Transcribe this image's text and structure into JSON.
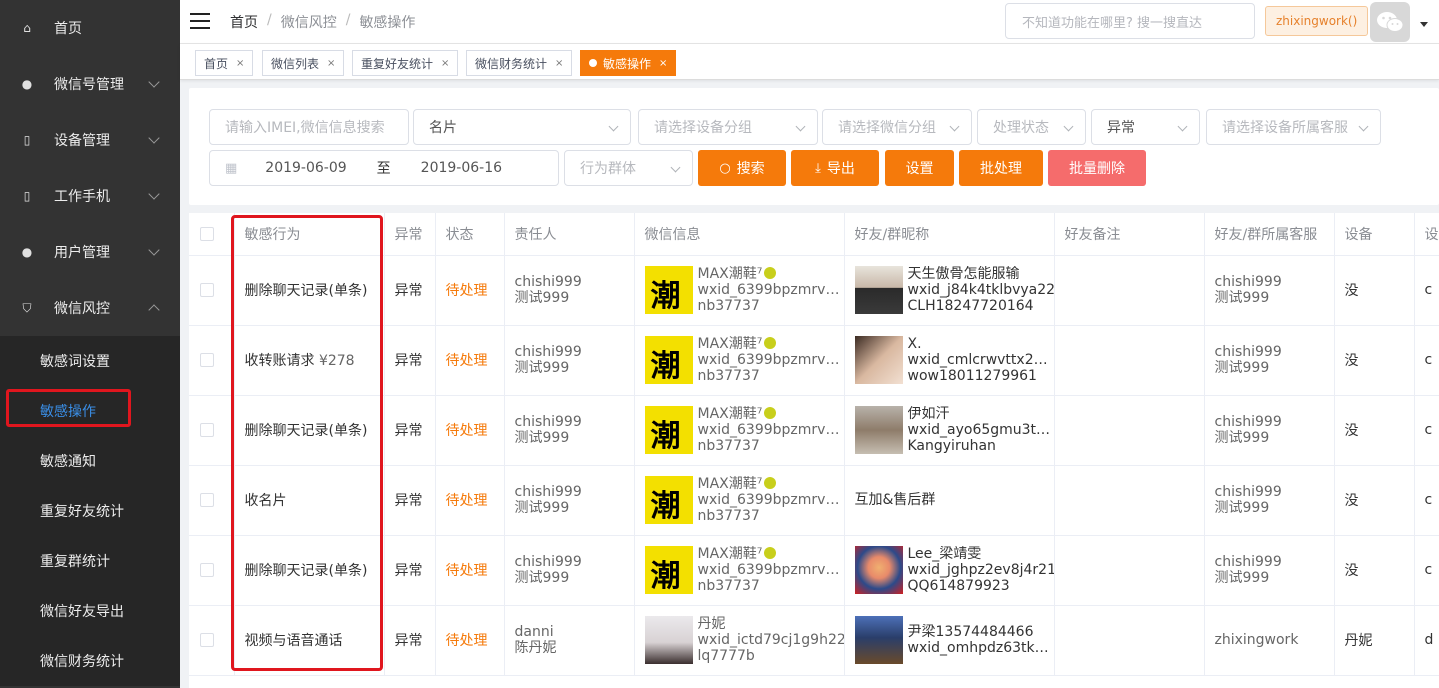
{
  "sidebar": {
    "items": [
      {
        "label": "首页",
        "icon": "home-icon"
      },
      {
        "label": "微信号管理",
        "icon": "wechat-icon"
      },
      {
        "label": "设备管理",
        "icon": "device-icon"
      },
      {
        "label": "工作手机",
        "icon": "phone-icon"
      },
      {
        "label": "用户管理",
        "icon": "user-icon"
      },
      {
        "label": "微信风控",
        "icon": "shield-icon"
      }
    ],
    "submenu": [
      "敏感词设置",
      "敏感操作",
      "敏感通知",
      "重复好友统计",
      "重复群统计",
      "微信好友导出",
      "微信财务统计"
    ]
  },
  "header": {
    "breadcrumb": [
      "首页",
      "微信风控",
      "敏感操作"
    ],
    "search_placeholder": "不知道功能在哪里? 搜一搜直达",
    "user_tag": "zhixingwork()"
  },
  "tags": [
    "首页",
    "微信列表",
    "重复好友统计",
    "微信财务统计",
    "敏感操作"
  ],
  "filters": {
    "imei_placeholder": "请输入IMEI,微信信息搜索",
    "type_value": "名片",
    "device_group": "请选择设备分组",
    "wechat_group": "请选择微信分组",
    "status": "处理状态",
    "abnormal": "异常",
    "service": "请选择设备所属客服",
    "date_from": "2019-06-09",
    "date_to_label": "至",
    "date_to": "2019-06-16",
    "behavior_group": "行为群体",
    "search_btn": "搜索",
    "export_btn": "导出",
    "settings_btn": "设置",
    "batch_btn": "批处理",
    "batch_delete_btn": "批量删除"
  },
  "table": {
    "columns": [
      "敏感行为",
      "异常",
      "状态",
      "责任人",
      "微信信息",
      "好友/群昵称",
      "好友备注",
      "好友/群所属客服",
      "设备",
      "设"
    ],
    "rows": [
      {
        "action": "删除聊天记录(单条)",
        "amount": "",
        "abnormal": "异常",
        "status": "待处理",
        "owner": [
          "chishi999",
          "测试999"
        ],
        "wx": [
          "MAX潮鞋⁷",
          "wxid_6399bpzmrv…",
          "nb37737"
        ],
        "wx_thumb": "yellow",
        "friend": [
          "天生傲骨怎能服输",
          "wxid_j84k4tklbvya22",
          "CLH18247720164"
        ],
        "friend_thumb": "p1",
        "remark": "",
        "service": [
          "chishi999",
          "测试999"
        ],
        "device": "没",
        "extra": "c"
      },
      {
        "action": "收转账请求",
        "amount": "¥278",
        "abnormal": "异常",
        "status": "待处理",
        "owner": [
          "chishi999",
          "测试999"
        ],
        "wx": [
          "MAX潮鞋⁷",
          "wxid_6399bpzmrv…",
          "nb37737"
        ],
        "wx_thumb": "yellow",
        "friend": [
          "X.",
          "wxid_cmlcrwvttx2…",
          "wow18011279961"
        ],
        "friend_thumb": "p2",
        "remark": "",
        "service": [
          "chishi999",
          "测试999"
        ],
        "device": "没",
        "extra": "c"
      },
      {
        "action": "删除聊天记录(单条)",
        "amount": "",
        "abnormal": "异常",
        "status": "待处理",
        "owner": [
          "chishi999",
          "测试999"
        ],
        "wx": [
          "MAX潮鞋⁷",
          "wxid_6399bpzmrv…",
          "nb37737"
        ],
        "wx_thumb": "yellow",
        "friend": [
          "伊如汗",
          "wxid_ayo65gmu3t…",
          "Kangyiruhan"
        ],
        "friend_thumb": "p3",
        "remark": "",
        "service": [
          "chishi999",
          "测试999"
        ],
        "device": "没",
        "extra": "c"
      },
      {
        "action": "收名片",
        "amount": "",
        "abnormal": "异常",
        "status": "待处理",
        "owner": [
          "chishi999",
          "测试999"
        ],
        "wx": [
          "MAX潮鞋⁷",
          "wxid_6399bpzmrv…",
          "nb37737"
        ],
        "wx_thumb": "yellow",
        "friend": [
          "互加&售后群",
          "",
          ""
        ],
        "friend_thumb": "",
        "remark": "",
        "service": [
          "chishi999",
          "测试999"
        ],
        "device": "没",
        "extra": "c"
      },
      {
        "action": "删除聊天记录(单条)",
        "amount": "",
        "abnormal": "异常",
        "status": "待处理",
        "owner": [
          "chishi999",
          "测试999"
        ],
        "wx": [
          "MAX潮鞋⁷",
          "wxid_6399bpzmrv…",
          "nb37737"
        ],
        "wx_thumb": "yellow",
        "friend": [
          "Lee_梁靖雯",
          "wxid_jghpz2ev8j4r21",
          "QQ614879923"
        ],
        "friend_thumb": "p4",
        "remark": "",
        "service": [
          "chishi999",
          "测试999"
        ],
        "device": "没",
        "extra": "c"
      },
      {
        "action": "视频与语音通话",
        "amount": "",
        "abnormal": "异常",
        "status": "待处理",
        "owner": [
          "danni",
          "陈丹妮"
        ],
        "wx": [
          "丹妮",
          "wxid_ictd79cj1g9h22",
          "lq7777b"
        ],
        "wx_thumb": "p5",
        "friend": [
          "尹梁13574484466",
          "wxid_omhpdz63tk…",
          ""
        ],
        "friend_thumb": "p6",
        "remark": "",
        "service": [
          "zhixingwork",
          ""
        ],
        "device": "丹妮",
        "extra": "d"
      }
    ]
  }
}
